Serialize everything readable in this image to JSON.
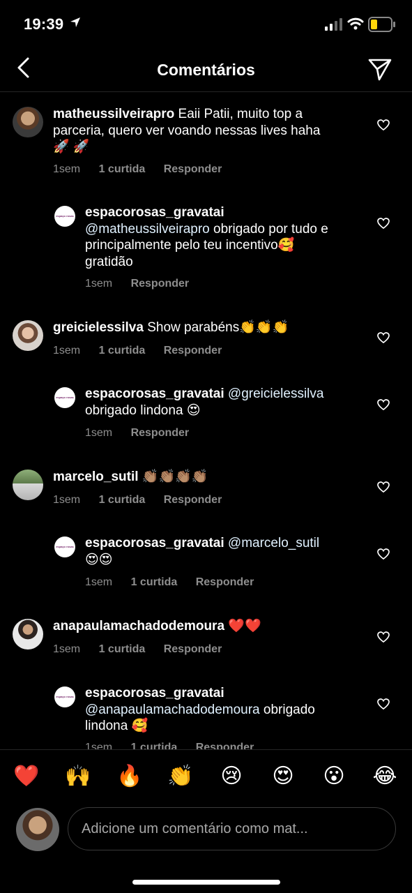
{
  "status": {
    "time": "19:39"
  },
  "header": {
    "title": "Comentários"
  },
  "comments": [
    {
      "user": "matheussilveirapro",
      "text_lines": [
        "Eaii Patii, muito top a",
        "parceria, quero ver voando nessas lives haha",
        "🚀 🚀"
      ],
      "time": "1sem",
      "likes": "1 curtida",
      "reply": "Responder"
    },
    {
      "user": "espacorosas_gravatai",
      "mention": "@matheussilveirapro",
      "text_lines": [
        "obrigado por tudo e",
        "principalmente pelo teu incentivo🥰",
        "gratidão"
      ],
      "time": "1sem",
      "reply": "Responder"
    },
    {
      "user": "greicielessilva",
      "text": "Show parabéns👏👏👏",
      "time": "1sem",
      "likes": "1 curtida",
      "reply": "Responder"
    },
    {
      "user": "espacorosas_gravatai",
      "mention": "@greicielessilva",
      "text": "obrigado lindona 😍",
      "time": "1sem",
      "reply": "Responder"
    },
    {
      "user": "marcelo_sutil",
      "text": "👏🏽👏🏽👏🏽👏🏽",
      "time": "1sem",
      "likes": "1 curtida",
      "reply": "Responder"
    },
    {
      "user": "espacorosas_gravatai",
      "mention": "@marcelo_sutil",
      "text": "😍😍",
      "time": "1sem",
      "likes": "1 curtida",
      "reply": "Responder"
    },
    {
      "user": "anapaulamachadodemoura",
      "text": "❤️❤️",
      "time": "1sem",
      "likes": "1 curtida",
      "reply": "Responder"
    },
    {
      "user": "espacorosas_gravatai",
      "mention": "@anapaulamachadodemoura",
      "text_lines": [
        "obrigado",
        "lindona 🥰"
      ],
      "time": "1sem",
      "likes": "1 curtida",
      "reply": "Responder"
    }
  ],
  "brand_avatar_text": "espaço rosas",
  "emoji_bar": [
    "❤️",
    "🙌",
    "🔥",
    "👏",
    "😢",
    "😍",
    "😮",
    "😂"
  ],
  "composer": {
    "placeholder": "Adicione um comentário como mat..."
  },
  "colors": {
    "background": "#000000",
    "secondary_text": "#8e8e8e",
    "mention": "#e0f1ff",
    "divider": "#262626"
  }
}
